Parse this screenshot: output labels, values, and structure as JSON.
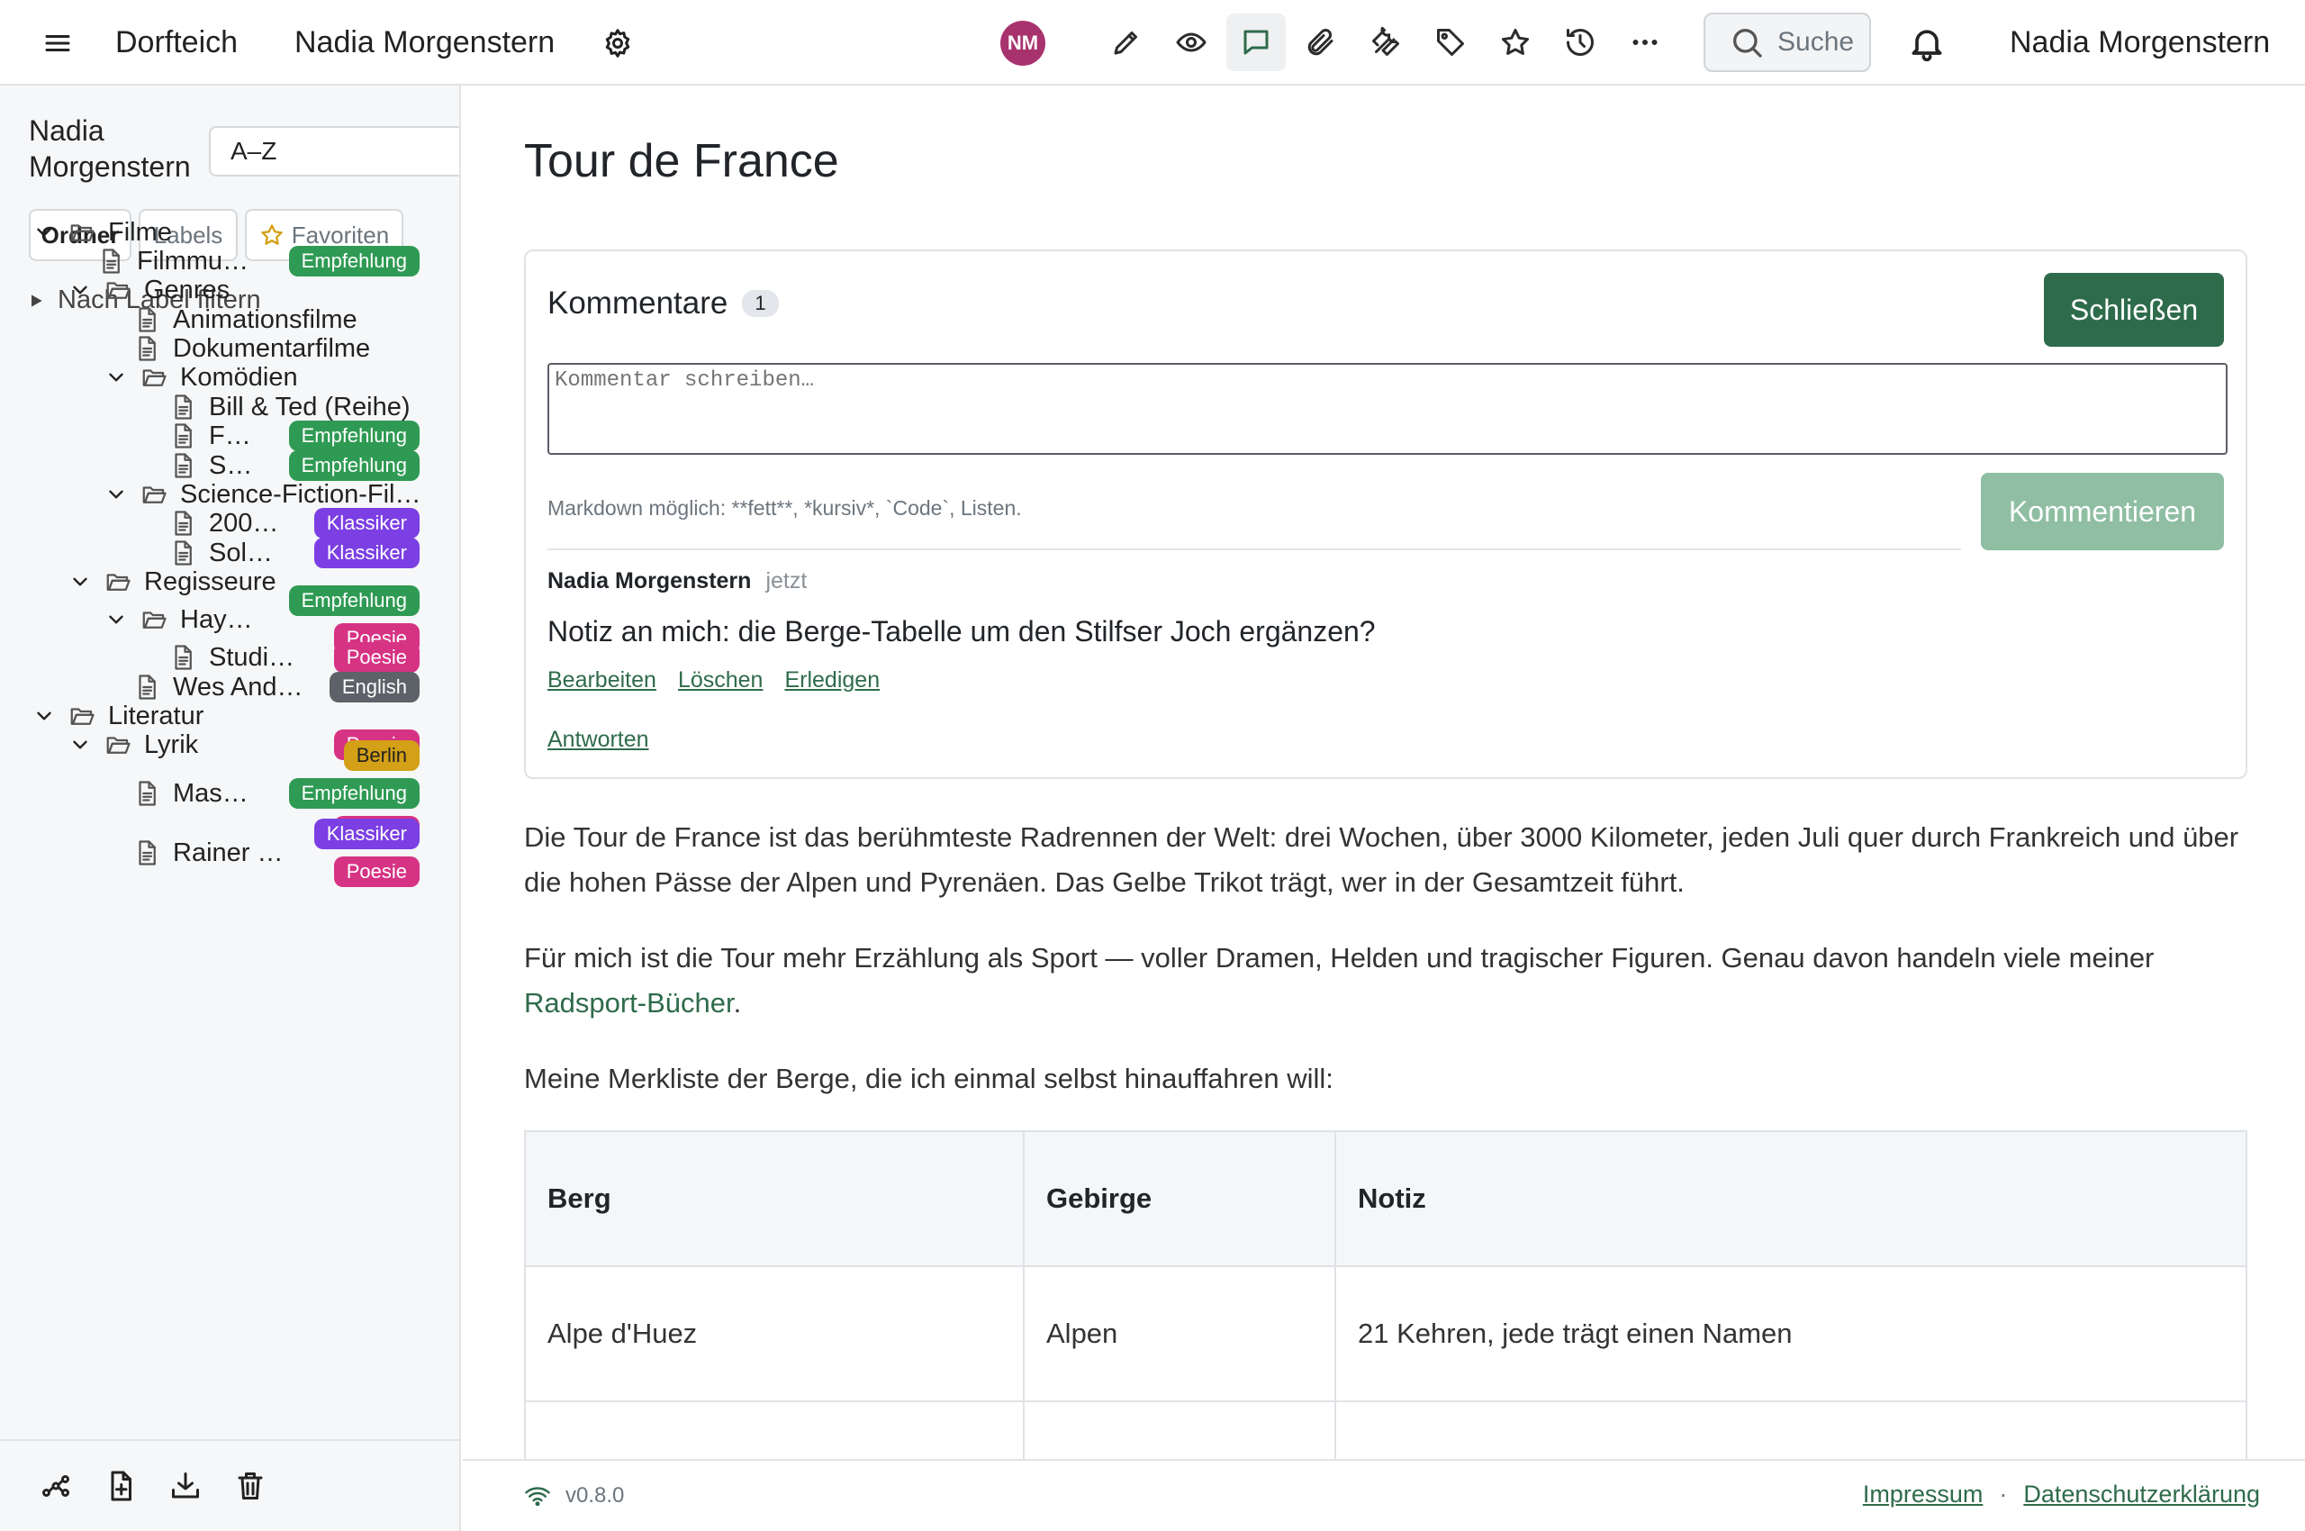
{
  "topbar": {
    "brand": "Dorfteich",
    "user_name": "Nadia Morgenstern",
    "avatar_initials": "NM",
    "search_label": "Suche",
    "account_name": "Nadia Morgenstern"
  },
  "sidebar": {
    "user_name": "Nadia Morgenstern",
    "sort_value": "A–Z",
    "segments": [
      "Ordner",
      "Labels",
      "Favoriten"
    ],
    "label_filter": "Nach Label filtern",
    "tree": [
      {
        "label": "Filme",
        "type": "folder",
        "expanded": true,
        "badges": []
      },
      {
        "label": "Filmmu…",
        "type": "file",
        "badges": [
          "Empfehlung"
        ]
      },
      {
        "label": "Genres",
        "type": "folder",
        "expanded": true,
        "badges": []
      },
      {
        "label": "Animationsfilme",
        "type": "file",
        "badges": []
      },
      {
        "label": "Dokumentarfilme",
        "type": "file",
        "badges": []
      },
      {
        "label": "Komödien",
        "type": "folder",
        "expanded": true,
        "badges": []
      },
      {
        "label": "Bill & Ted (Reihe)",
        "type": "file",
        "badges": []
      },
      {
        "label": "F…",
        "type": "file",
        "badges": [
          "Empfehlung"
        ]
      },
      {
        "label": "S…",
        "type": "file",
        "badges": [
          "Empfehlung"
        ]
      },
      {
        "label": "Science-Fiction-Fil…",
        "type": "folder",
        "expanded": true,
        "badges": []
      },
      {
        "label": "200…",
        "type": "file",
        "badges": [
          "Klassiker"
        ]
      },
      {
        "label": "Sol…",
        "type": "file",
        "badges": [
          "Klassiker"
        ]
      },
      {
        "label": "Regisseure",
        "type": "folder",
        "expanded": true,
        "badges": []
      },
      {
        "label": "Hay…",
        "type": "folder",
        "expanded": true,
        "badges": [
          "Empfehlung",
          "Poesie"
        ]
      },
      {
        "label": "Studi…",
        "type": "file",
        "badges": [
          "Poesie"
        ]
      },
      {
        "label": "Wes And…",
        "type": "file",
        "badges": [
          "English"
        ]
      },
      {
        "label": "Literatur",
        "type": "folder",
        "expanded": true,
        "badges": []
      },
      {
        "label": "Lyrik",
        "type": "folder",
        "expanded": true,
        "badges": [
          "Poesie"
        ]
      },
      {
        "label": "Mas…",
        "type": "file",
        "badges": [
          "Berlin",
          "Empfehlung",
          "Poesie"
        ]
      },
      {
        "label": "Rainer …",
        "type": "file",
        "badges": [
          "Klassiker",
          "Poesie"
        ]
      }
    ],
    "bottom_icons": [
      "graph-icon",
      "new-file-icon",
      "import-icon",
      "trash-icon"
    ]
  },
  "main": {
    "title": "Tour de France",
    "comments": {
      "heading": "Kommentare",
      "count": "1",
      "close_label": "Schließen",
      "placeholder": "Kommentar schreiben…",
      "markdown_hint": "Markdown möglich: **fett**, *kursiv*, `Code`, Listen.",
      "submit_label": "Kommentieren",
      "items": [
        {
          "author": "Nadia Morgenstern",
          "time": "jetzt",
          "text": "Notiz an mich: die Berge-Tabelle um den Stilfser Joch ergänzen?",
          "actions": [
            "Bearbeiten",
            "Löschen",
            "Erledigen"
          ],
          "reply": "Antworten"
        }
      ]
    },
    "para1": "Die Tour de France ist das berühmteste Radrennen der Welt: drei Wochen, über 3000 Kilometer, jeden Juli quer durch Frankreich und über die hohen Pässe der Alpen und Pyrenäen. Das Gelbe Trikot trägt, wer in der Gesamtzeit führt.",
    "para2_before": "Für mich ist die Tour mehr Erzählung als Sport — voller Dramen, Helden und tragischer Figuren. Genau davon handeln viele meiner ",
    "para2_link": "Radsport-Bücher",
    "para2_after": ".",
    "para3": "Meine Merkliste der Berge, die ich einmal selbst hinauffahren will:",
    "table": {
      "headers": [
        "Berg",
        "Gebirge",
        "Notiz"
      ],
      "rows": [
        [
          "Alpe d'Huez",
          "Alpen",
          "21 Kehren, jede trägt einen Namen"
        ]
      ]
    }
  },
  "footer": {
    "version": "v0.8.0",
    "links": [
      "Impressum",
      "Datenschutzerklärung"
    ],
    "separator": "·"
  },
  "colors": {
    "accent": "#2e6b4a",
    "accent_light": "#8fbea3",
    "avatar": "#a8326e",
    "empfehlung": "#2f9a53",
    "klassiker": "#7b3fe4",
    "poesie": "#d63384",
    "english": "#5d6268",
    "berlin": "#d4a017"
  }
}
